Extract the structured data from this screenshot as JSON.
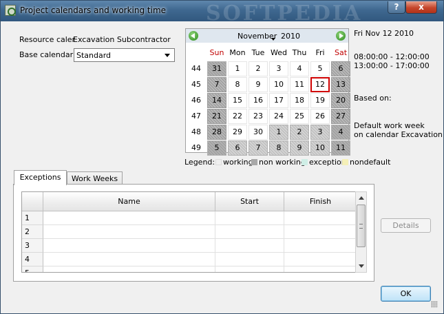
{
  "window": {
    "title": "Project calendars and working time",
    "watermark": "SOFTPEDIA",
    "help_label": "?",
    "close_label": "x"
  },
  "form": {
    "resource_label": "Resource caler",
    "resource_value": "Excavation Subcontractor",
    "base_label": "Base calendar:",
    "base_value": "Standard"
  },
  "calendar": {
    "month": "November",
    "year": "2010",
    "weekdays": [
      "Sun",
      "Mon",
      "Tue",
      "Wed",
      "Thu",
      "Fri",
      "Sat"
    ],
    "weeks": [
      "44",
      "45",
      "46",
      "47",
      "48",
      "49"
    ],
    "days": [
      [
        "31",
        "1",
        "2",
        "3",
        "4",
        "5",
        "6"
      ],
      [
        "7",
        "8",
        "9",
        "10",
        "11",
        "12",
        "13"
      ],
      [
        "14",
        "15",
        "16",
        "17",
        "18",
        "19",
        "20"
      ],
      [
        "21",
        "22",
        "23",
        "24",
        "25",
        "26",
        "27"
      ],
      [
        "28",
        "29",
        "30",
        "1",
        "2",
        "3",
        "4"
      ],
      [
        "5",
        "6",
        "7",
        "8",
        "9",
        "10",
        "11"
      ]
    ],
    "selected_day": "12"
  },
  "legend": {
    "title": "Legend:",
    "items": [
      {
        "label": "working",
        "color": "#ffffff"
      },
      {
        "label": "non working",
        "color": "#a9a9a9"
      },
      {
        "label": "exception",
        "color": "#cfeee6"
      },
      {
        "label": "nondefault",
        "color": "#f5f0b8"
      }
    ]
  },
  "info": {
    "date": "Fri Nov 12 2010",
    "time1": "08:00:00 - 12:00:00",
    "time2": "13:00:00 - 17:00:00",
    "based_on": "Based on:",
    "default_line1": "Default work week",
    "default_line2": "on calendar Excavation"
  },
  "tabs": [
    {
      "label": "Exceptions",
      "active": true
    },
    {
      "label": "Work Weeks",
      "active": false
    }
  ],
  "grid": {
    "columns": [
      "Name",
      "Start",
      "Finish"
    ],
    "rows": [
      "1",
      "2",
      "3",
      "4",
      "5"
    ]
  },
  "buttons": {
    "details": "Details",
    "ok": "OK"
  },
  "colors": {
    "selected_border": "#d00000",
    "weekend_red": "#c00000",
    "nav_green": "#2b8a1c"
  }
}
